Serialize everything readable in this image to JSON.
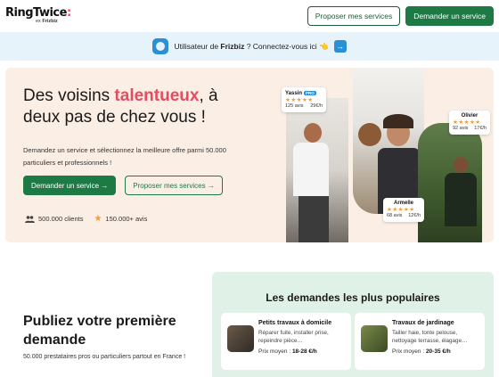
{
  "header": {
    "logo_main": "RingTwice",
    "logo_dot": ":",
    "logo_sub_prefix": "ex ",
    "logo_sub_brand": "Frizbiz",
    "offer_services_label": "Proposer mes services",
    "request_service_label": "Demander un service"
  },
  "banner": {
    "text_prefix": "Utilisateur de ",
    "brand": "Frizbiz",
    "text_suffix": " ? Connectez-vous ici",
    "hand_emoji": "👈"
  },
  "hero": {
    "title_part1": "Des voisins ",
    "title_highlight": "talentueux",
    "title_part2": ", à deux pas de chez vous !",
    "description": "Demandez un service et sélectionnez la meilleure offre parmi 50.000 particuliers et professionnels !",
    "request_button": "Demander un service →",
    "offer_button": "Proposer mes services →",
    "stats": [
      {
        "icon": "users-icon",
        "text": "500.000 clients"
      },
      {
        "icon": "star-icon",
        "text": "150.000+ avis"
      }
    ],
    "reviews": [
      {
        "name": "Yassin",
        "badge": "PRO",
        "stars": "★★★★★",
        "count": "125 avis",
        "price": "29€/h"
      },
      {
        "name": "Olivier",
        "badge": "",
        "stars": "★★★★★",
        "count": "92 avis",
        "price": "17€/h"
      },
      {
        "name": "Armelle",
        "badge": "",
        "stars": "★★★★★",
        "count": "68 avis",
        "price": "12€/h"
      }
    ]
  },
  "publish": {
    "title": "Publiez votre première demande",
    "subtitle": "50.000 prestataires pros ou particuliers partout en France !"
  },
  "popular": {
    "title": "Les demandes les plus populaires",
    "cards": [
      {
        "title": "Petits travaux à domicile",
        "description": "Réparer fuite, installer prise, repeindre pièce…",
        "price_label": "Prix moyen : ",
        "price": "18-28 €/h"
      },
      {
        "title": "Travaux de jardinage",
        "description": "Tailler haie, tonte pelouse, nettoyage terrasse, élagage…",
        "price_label": "Prix moyen : ",
        "price": "20-35 €/h"
      }
    ]
  },
  "colors": {
    "brand_green": "#1e7a45",
    "accent_red": "#e84a5f",
    "banner_bg": "#e6f3fb",
    "hero_bg": "#fbeee4",
    "popular_bg": "#e0f1e7"
  }
}
